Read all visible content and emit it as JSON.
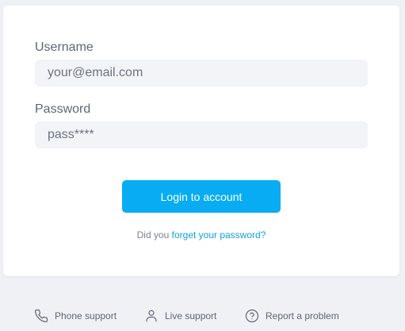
{
  "form": {
    "username_label": "Username",
    "username_placeholder": "your@email.com",
    "password_label": "Password",
    "password_placeholder": "pass****",
    "login_button": "Login to account",
    "forgot_prefix": "Did you ",
    "forgot_link": "forget your password?"
  },
  "footer": {
    "items": [
      {
        "label": "Phone support",
        "icon": "phone-icon"
      },
      {
        "label": "Live support",
        "icon": "user-icon"
      },
      {
        "label": "Report a problem",
        "icon": "help-circle-icon"
      }
    ]
  },
  "colors": {
    "accent": "#08acf2",
    "link": "#14a0e0",
    "background": "#eff1f5",
    "field_bg": "#f3f4f7"
  }
}
